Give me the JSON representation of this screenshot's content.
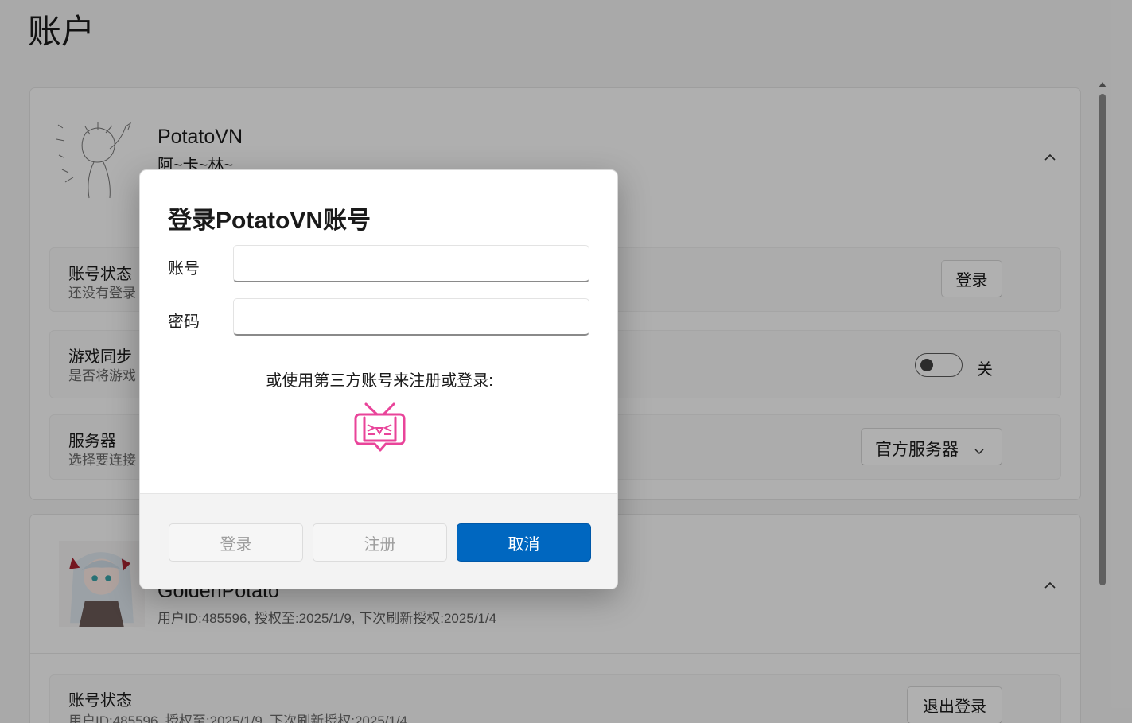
{
  "page": {
    "title": "账户"
  },
  "potato_card": {
    "name": "PotatoVN",
    "subtitle": "阿~卡~林~",
    "rows": {
      "status": {
        "title": "账号状态",
        "desc": "还没有登录",
        "button": "登录"
      },
      "sync": {
        "title": "游戏同步",
        "desc": "是否将游戏",
        "toggle_label": "关"
      },
      "server": {
        "title": "服务器",
        "desc": "选择要连接",
        "selected": "官方服务器"
      }
    }
  },
  "bangumi_card": {
    "name": "GoldenPotato",
    "info": "用户ID:485596, 授权至:2025/1/9, 下次刷新授权:2025/1/4",
    "rows": {
      "status": {
        "title": "账号状态",
        "desc": "用户ID:485596, 授权至:2025/1/9, 下次刷新授权:2025/1/4",
        "button": "退出登录"
      }
    }
  },
  "dialog": {
    "title": "登录PotatoVN账号",
    "account_label": "账号",
    "account_value": "",
    "password_label": "密码",
    "password_value": "",
    "third_party_hint": "或使用第三方账号来注册或登录:",
    "buttons": {
      "login": "登录",
      "register": "注册",
      "cancel": "取消"
    }
  },
  "colors": {
    "accent": "#0067c0",
    "bilibili_pink": "#e9449a"
  },
  "icons": {
    "chevron_up": "chevron-up-icon",
    "chevron_down": "chevron-down-icon",
    "bilibili": "bilibili-tv-icon"
  }
}
